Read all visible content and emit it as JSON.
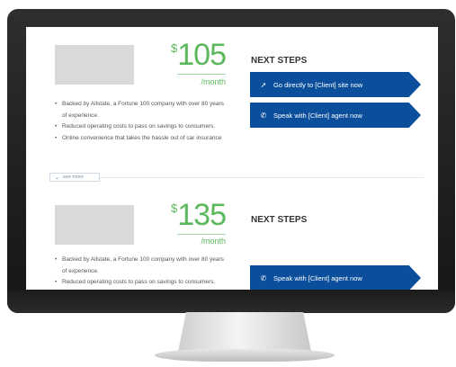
{
  "offers": [
    {
      "currency": "$",
      "price": "105",
      "per": "/month",
      "bullets": [
        "Backed by Allstate, a Fortune 100 company with over 80 years of experience.",
        "Reduced operating costs to pass on savings to consumers.",
        "Online convenience that takes the hassle out of car insurance"
      ],
      "next_steps_label": "NEXT STEPS",
      "cta_site_label": "Go directly to [Client] site now",
      "cta_agent_label": "Speak with [Client] agent now",
      "see_more_label": "see more"
    },
    {
      "currency": "$",
      "price": "135",
      "per": "/month",
      "bullets": [
        "Backed by Allstate, a Fortune 100 company with over 80 years of experience.",
        "Reduced operating costs to pass on savings to consumers."
      ],
      "next_steps_label": "NEXT STEPS",
      "cta_agent_label": "Speak with [Client] agent now"
    }
  ],
  "icons": {
    "site": "arrow-icon",
    "agent": "phone-icon",
    "see_more": "chevron-down-icon"
  },
  "colors": {
    "price_green": "#5cb85c",
    "cta_blue": "#0b4f9c"
  }
}
